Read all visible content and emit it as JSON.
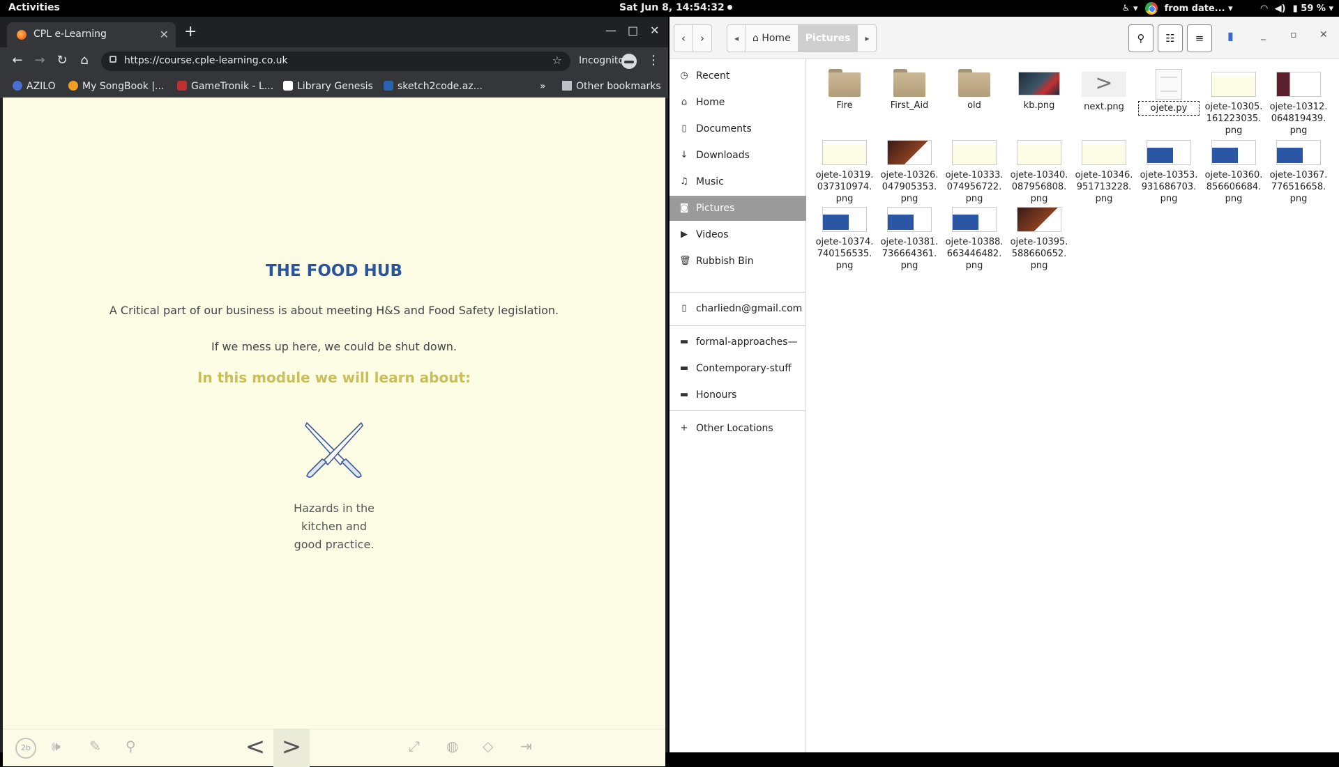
{
  "topbar": {
    "activities": "Activities",
    "clock": "Sat Jun  8, 14:54:32",
    "app_title": "from date...",
    "battery": "59 %"
  },
  "browser": {
    "tab_title": "CPL e-Learning",
    "url": "https://course.cple-learning.co.uk",
    "incognito_label": "Incognito",
    "bookmarks": [
      {
        "label": "AZILO",
        "color": "#4a6fd0"
      },
      {
        "label": "My SongBook |...",
        "color": "#f0a020"
      },
      {
        "label": "GameTronik - L...",
        "color": "#c03030"
      },
      {
        "label": "Library Genesis",
        "color": "#ffffff"
      },
      {
        "label": "sketch2code.az...",
        "color": "#2a64b0"
      }
    ],
    "other_bookmarks": "Other bookmarks",
    "overflow": "»"
  },
  "course": {
    "heading": "THE FOOD HUB",
    "paragraph1": "A Critical part of our business is about meeting H&S and Food Safety legislation.",
    "paragraph2": "If we mess up here, we could be shut down.",
    "subheading": "In this module we will learn about:",
    "topic_lines": [
      "Hazards in the",
      "kitchen and",
      "good practice."
    ],
    "player_badge": "2b",
    "prev": "<",
    "next": ">"
  },
  "files": {
    "path": [
      "Home",
      "Pictures"
    ],
    "sidebar": [
      {
        "label": "Recent",
        "icon": "clock-icon"
      },
      {
        "label": "Home",
        "icon": "home-icon"
      },
      {
        "label": "Documents",
        "icon": "document-icon"
      },
      {
        "label": "Downloads",
        "icon": "download-icon"
      },
      {
        "label": "Music",
        "icon": "music-icon"
      },
      {
        "label": "Pictures",
        "icon": "camera-icon"
      },
      {
        "label": "Videos",
        "icon": "video-icon"
      },
      {
        "label": "Rubbish Bin",
        "icon": "trash-icon"
      },
      {
        "label": "charliedn@gmail.com",
        "icon": "phone-icon"
      },
      {
        "label": "formal-approaches—",
        "icon": "folder-icon"
      },
      {
        "label": "Contemporary-stuff",
        "icon": "folder-icon"
      },
      {
        "label": "Honours",
        "icon": "folder-icon"
      },
      {
        "label": "Other Locations",
        "icon": "plus-icon"
      }
    ],
    "items": [
      {
        "name": "Fire",
        "kind": "folder"
      },
      {
        "name": "First_Aid",
        "kind": "folder"
      },
      {
        "name": "old",
        "kind": "folder"
      },
      {
        "name": "kb.png",
        "kind": "kb"
      },
      {
        "name": "next.png",
        "kind": "next"
      },
      {
        "name": "ojete.py",
        "kind": "doc"
      },
      {
        "name": "ojete-10305.161223035.png",
        "kind": "yellow"
      },
      {
        "name": "ojete-10312.064819439.png",
        "kind": "dark2"
      },
      {
        "name": "ojete-10319.037310974.png",
        "kind": "yellow"
      },
      {
        "name": "ojete-10326.047905353.png",
        "kind": "dark"
      },
      {
        "name": "ojete-10333.074956722.png",
        "kind": "yellow"
      },
      {
        "name": "ojete-10340.087956808.png",
        "kind": "yellow"
      },
      {
        "name": "ojete-10346.951713228.png",
        "kind": "yellow"
      },
      {
        "name": "ojete-10353.931686703.png",
        "kind": "blue"
      },
      {
        "name": "ojete-10360.856606684.png",
        "kind": "blue"
      },
      {
        "name": "ojete-10367.776516658.png",
        "kind": "blue"
      },
      {
        "name": "ojete-10374.740156535.png",
        "kind": "blue"
      },
      {
        "name": "ojete-10381.736664361.png",
        "kind": "blue"
      },
      {
        "name": "ojete-10388.663446482.png",
        "kind": "blue"
      },
      {
        "name": "ojete-10395.588660652.png",
        "kind": "dark"
      }
    ]
  }
}
